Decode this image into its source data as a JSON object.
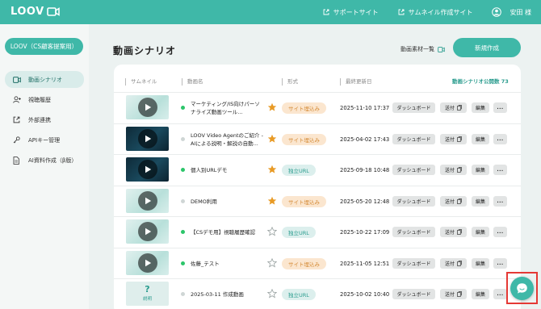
{
  "header": {
    "logo": "LOOV",
    "support_link": "サポートサイト",
    "thumbnail_link": "サムネイル作成サイト",
    "user_name": "安田 様"
  },
  "sidebar": {
    "brand_button": "LOOV（CS顧客提案用）",
    "items": [
      {
        "label": "動画シナリオ",
        "icon": "video-icon",
        "active": true
      },
      {
        "label": "視聴履歴",
        "icon": "user-plus-icon",
        "active": false
      },
      {
        "label": "外部連携",
        "icon": "external-link-icon",
        "active": false
      },
      {
        "label": "APIキー管理",
        "icon": "key-icon",
        "active": false
      },
      {
        "label": "AI資料作成（β版）",
        "icon": "document-icon",
        "active": false
      }
    ]
  },
  "main": {
    "title": "動画シナリオ",
    "asset_list_link": "動画素材一覧",
    "new_button": "新規作成",
    "table": {
      "columns": [
        "サムネイル",
        "動画名",
        "形式",
        "最終更新日"
      ],
      "published_count_label": "動画シナリオ公開数 73",
      "rows": [
        {
          "thumb": "light",
          "status": "on",
          "name": "マーケティング/IS向けパーソナライズ動画ツール...",
          "starred": true,
          "format": "サイト埋込み",
          "format_type": "embed",
          "updated": "2025-11-10 17:37"
        },
        {
          "thumb": "dark",
          "status": "off",
          "name": "LOOV Video Agentのご紹介 - AIによる説明・解説の自動...",
          "starred": true,
          "format": "サイト埋込み",
          "format_type": "embed",
          "updated": "2025-04-02 17:43"
        },
        {
          "thumb": "dark",
          "status": "on",
          "name": "個人別URLデモ",
          "starred": true,
          "format": "独立URL",
          "format_type": "standalone",
          "updated": "2025-09-18 10:48"
        },
        {
          "thumb": "light",
          "status": "off",
          "name": "DEMO利用",
          "starred": true,
          "format": "サイト埋込み",
          "format_type": "embed",
          "updated": "2025-05-20 12:48"
        },
        {
          "thumb": "light",
          "status": "on",
          "name": "【CSデモ用】視聴履歴確認",
          "starred": false,
          "format": "独立URL",
          "format_type": "standalone",
          "updated": "2025-10-22 17:09"
        },
        {
          "thumb": "light",
          "status": "on",
          "name": "佐藤_テスト",
          "starred": false,
          "format": "サイト埋込み",
          "format_type": "embed",
          "updated": "2025-11-05 12:51"
        },
        {
          "thumb": "unknown",
          "thumb_label": "?",
          "thumb_caption": "説明",
          "status": "off",
          "name": "2025-03-11 作成動画",
          "starred": false,
          "format": "独立URL",
          "format_type": "standalone",
          "updated": "2025-10-02 10:40"
        }
      ],
      "actions": {
        "dashboard": "ダッシュボード",
        "send": "送付",
        "edit": "編集",
        "more": "..."
      }
    }
  },
  "colors": {
    "accent": "#3fb8a8",
    "star": "#e89a25",
    "embed_bg": "#fbe6cf",
    "standalone_bg": "#dcefed"
  }
}
